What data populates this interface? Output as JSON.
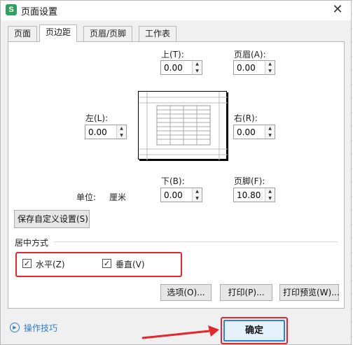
{
  "window": {
    "title": "页面设置",
    "app_icon_letter": "S",
    "close_glyph": "✕"
  },
  "tabs": [
    {
      "label": "页面",
      "active": false
    },
    {
      "label": "页边距",
      "active": true
    },
    {
      "label": "页眉/页脚",
      "active": false
    },
    {
      "label": "工作表",
      "active": false
    }
  ],
  "margins": {
    "top": {
      "label": "上(T):",
      "value": "0.00"
    },
    "header": {
      "label": "页眉(A):",
      "value": "0.00"
    },
    "left": {
      "label": "左(L):",
      "value": "0.00"
    },
    "right": {
      "label": "右(R):",
      "value": "0.00"
    },
    "bottom": {
      "label": "下(B):",
      "value": "0.00"
    },
    "footer": {
      "label": "页脚(F):",
      "value": "10.80"
    }
  },
  "unit": {
    "label": "单位:",
    "value": "厘米"
  },
  "save_custom_label": "保存自定义设置(S)",
  "centering": {
    "title": "居中方式",
    "horizontal": {
      "label": "水平(Z)",
      "checked": true
    },
    "vertical": {
      "label": "垂直(V)",
      "checked": true
    }
  },
  "buttons": {
    "options": "选项(O)...",
    "print": "打印(P)...",
    "print_preview": "打印预览(W)...",
    "ok": "确定"
  },
  "footer": {
    "tips_label": "操作技巧"
  },
  "colors": {
    "highlight": "#e5262a",
    "accent": "#2d83d7",
    "brand": "#2fa15c"
  }
}
